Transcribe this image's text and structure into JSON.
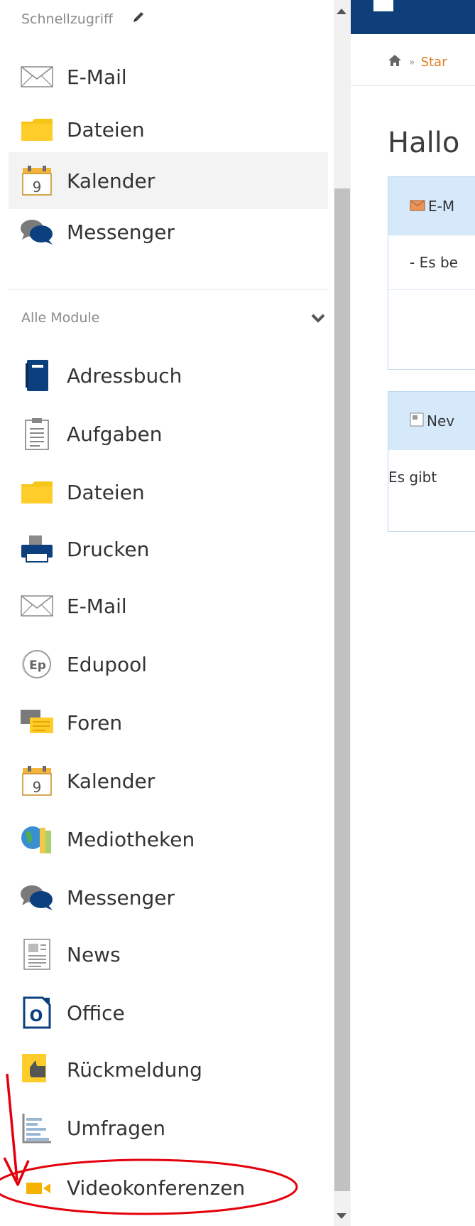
{
  "sidebar": {
    "quick_access": {
      "header": "Schnellzugriff",
      "items": [
        {
          "label": "E-Mail",
          "icon": "email-icon"
        },
        {
          "label": "Dateien",
          "icon": "folder-icon"
        },
        {
          "label": "Kalender",
          "icon": "calendar-icon",
          "active": true
        },
        {
          "label": "Messenger",
          "icon": "messenger-icon"
        }
      ]
    },
    "all_modules": {
      "header": "Alle Module",
      "items": [
        {
          "label": "Adressbuch",
          "icon": "addressbook-icon"
        },
        {
          "label": "Aufgaben",
          "icon": "tasks-icon"
        },
        {
          "label": "Dateien",
          "icon": "folder-icon"
        },
        {
          "label": "Drucken",
          "icon": "printer-icon"
        },
        {
          "label": "E-Mail",
          "icon": "email-icon"
        },
        {
          "label": "Edupool",
          "icon": "edupool-icon"
        },
        {
          "label": "Foren",
          "icon": "forum-icon"
        },
        {
          "label": "Kalender",
          "icon": "calendar-icon"
        },
        {
          "label": "Mediotheken",
          "icon": "mediothek-icon"
        },
        {
          "label": "Messenger",
          "icon": "messenger-icon"
        },
        {
          "label": "News",
          "icon": "news-icon"
        },
        {
          "label": "Office",
          "icon": "office-icon"
        },
        {
          "label": "Rückmeldung",
          "icon": "feedback-icon"
        },
        {
          "label": "Umfragen",
          "icon": "survey-icon"
        },
        {
          "label": "Videokonferenzen",
          "icon": "video-icon",
          "highlighted": true
        }
      ]
    },
    "calendar_day": "9",
    "office_letter": "O",
    "edupool_letters": "Ep"
  },
  "main": {
    "breadcrumb": {
      "separator": "»",
      "link": "Star"
    },
    "greeting": "Hallo",
    "email_panel": {
      "title": "E-M",
      "body": "- Es be"
    },
    "news_panel": {
      "title": "Nev",
      "body": "Es gibt"
    }
  },
  "colors": {
    "accent": "#e07b1f",
    "topbar": "#0f3f7a",
    "panel_header": "#d6e9fb",
    "annotation": "#e3000b"
  }
}
